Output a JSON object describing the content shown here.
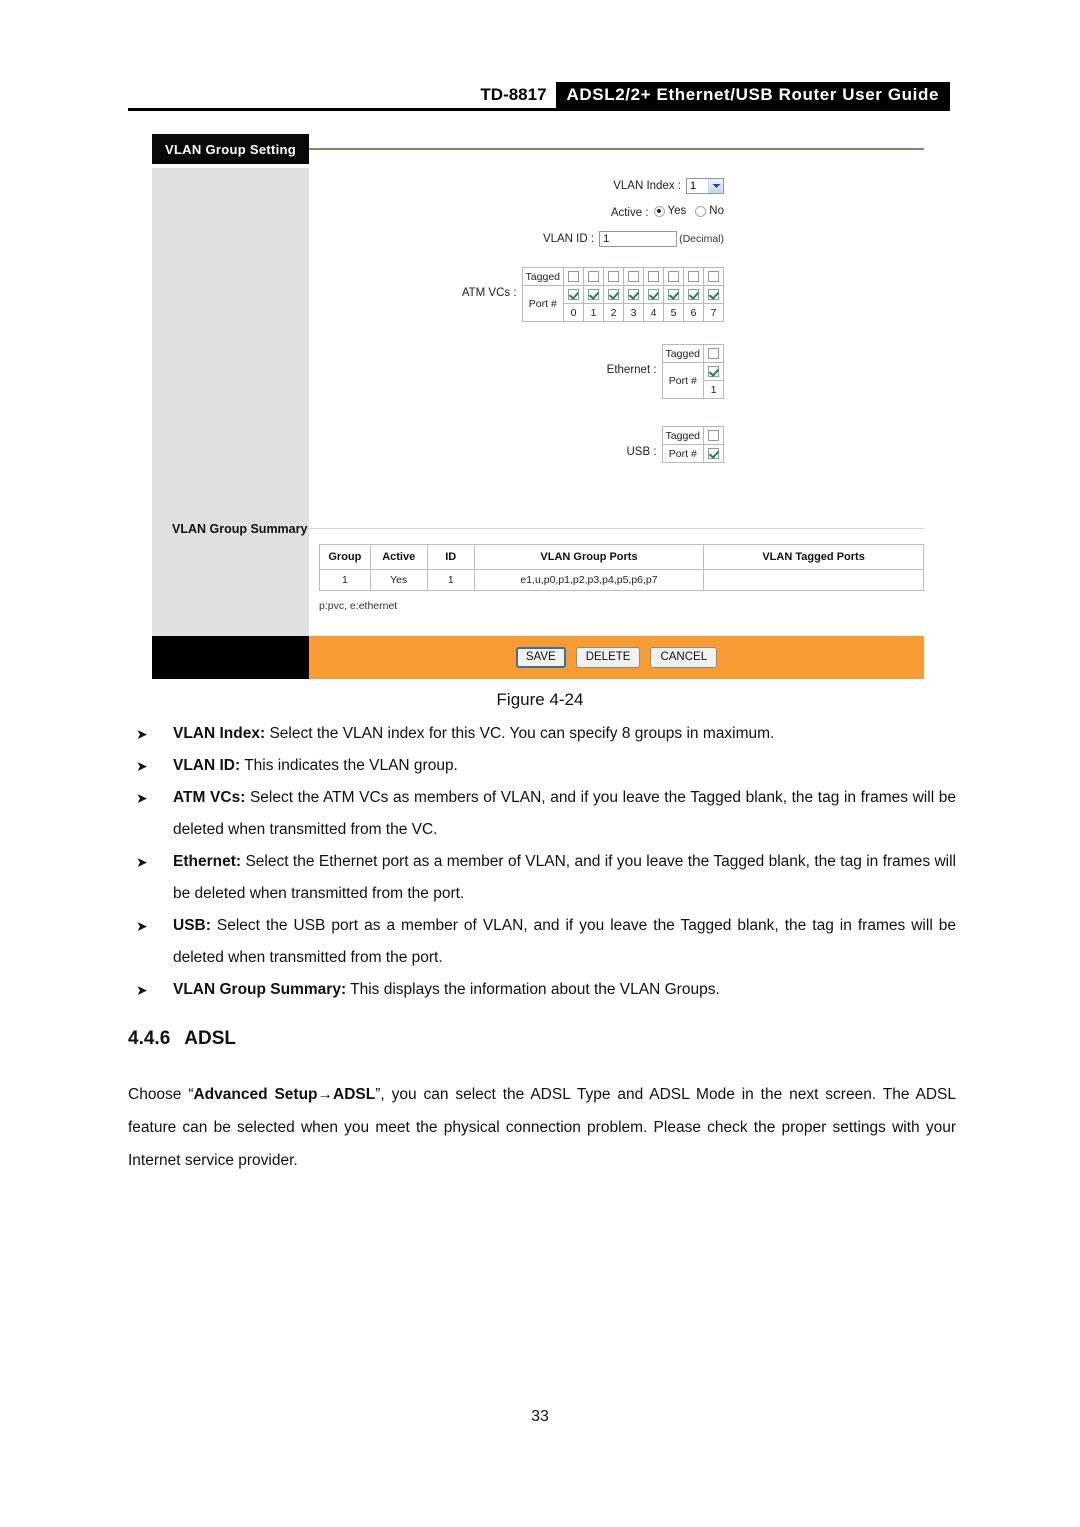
{
  "header": {
    "model": "TD-8817",
    "title": "ADSL2/2+ Ethernet/USB Router User Guide"
  },
  "figure": {
    "caption": "Figure 4-24",
    "panel_title": "VLAN Group Setting",
    "form": {
      "vlan_index_label": "VLAN Index :",
      "vlan_index_value": "1",
      "active_label": "Active :",
      "active_yes": "Yes",
      "active_no": "No",
      "active_selected": "Yes",
      "vlan_id_label": "VLAN ID :",
      "vlan_id_value": "1",
      "vlan_id_hint": "(Decimal)",
      "atm_vcs_label": "ATM VCs :",
      "ethernet_label": "Ethernet :",
      "usb_label": "USB :",
      "tagged_row_label": "Tagged",
      "port_row_label": "Port #",
      "atm_ports": [
        "0",
        "1",
        "2",
        "3",
        "4",
        "5",
        "6",
        "7"
      ],
      "atm_tagged_checked": [
        false,
        false,
        false,
        false,
        false,
        false,
        false,
        false
      ],
      "atm_port_checked": [
        true,
        true,
        true,
        true,
        true,
        true,
        true,
        true
      ],
      "ethernet_ports": [
        "1"
      ],
      "ethernet_tagged_checked": [
        false
      ],
      "ethernet_port_checked": [
        true
      ],
      "usb_tagged_checked": [
        false
      ],
      "usb_port_checked": [
        true
      ]
    },
    "summary": {
      "section_label": "VLAN Group Summary",
      "columns": [
        "Group",
        "Active",
        "ID",
        "VLAN Group Ports",
        "VLAN Tagged Ports"
      ],
      "rows": [
        [
          "1",
          "Yes",
          "1",
          "e1,u,p0,p1,p2,p3,p4,p5,p6,p7",
          ""
        ]
      ],
      "legend": "p:pvc, e:ethernet"
    },
    "buttons": {
      "save": "SAVE",
      "delete": "DELETE",
      "cancel": "CANCEL",
      "focused": "SAVE"
    },
    "colors": {
      "action_bar": "#f89b32",
      "title_bar": "#090909",
      "sidebar": "#e0e0e0",
      "check_green": "#1f8a2b"
    }
  },
  "bullets": [
    {
      "term": "VLAN Index:",
      "text": " Select the VLAN index for this VC. You can specify 8 groups in maximum."
    },
    {
      "term": "VLAN ID:",
      "text": " This indicates the VLAN group."
    },
    {
      "term": "ATM VCs:",
      "text": " Select the ATM VCs as members of VLAN, and if you leave the Tagged blank, the tag in frames will be deleted when transmitted from the VC."
    },
    {
      "term": "Ethernet:",
      "text": " Select the Ethernet port as a member of VLAN, and if you leave the Tagged blank, the tag in frames will be deleted when transmitted from the port."
    },
    {
      "term": "USB:",
      "text": " Select the USB port as a member of VLAN, and if you leave the Tagged blank, the tag in frames will be deleted when transmitted from the port."
    },
    {
      "term": "VLAN Group Summary:",
      "text": " This displays the information about the VLAN Groups."
    }
  ],
  "section": {
    "number": "4.4.6",
    "title": "ADSL",
    "paragraph_prefix": "Choose “",
    "paragraph_bold": "Advanced Setup→ADSL",
    "paragraph_suffix": "”, you can select the ADSL Type and ADSL Mode in the next screen. The ADSL feature can be selected when you meet the physical connection problem. Please check the proper settings with your Internet service provider."
  },
  "page_number": "33"
}
